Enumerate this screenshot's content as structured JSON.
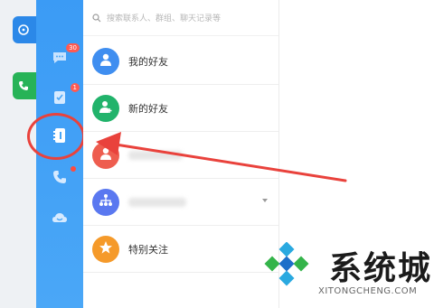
{
  "search": {
    "placeholder": "搜索联系人、群组、聊天记录等"
  },
  "rail": {
    "messages_badge": "30",
    "todo_badge": "1"
  },
  "contacts": {
    "items": [
      {
        "label": "我的好友",
        "color": "#3f8ef0",
        "icon": "person-icon"
      },
      {
        "label": "新的好友",
        "color": "#21b36b",
        "icon": "person-add-icon"
      },
      {
        "label": "",
        "color": "#ee5d4f",
        "icon": "person-icon"
      },
      {
        "label": "",
        "color": "#5a78f0",
        "icon": "org-chart-icon"
      },
      {
        "label": "特别关注",
        "color": "#f59a2a",
        "icon": "star-icon"
      }
    ]
  },
  "watermark": {
    "name": "系统城",
    "domain": "XITONGCHENG.COM"
  },
  "colors": {
    "rail": "#3b9bf5",
    "highlight": "#e9423c",
    "arrow": "#e9423c"
  }
}
